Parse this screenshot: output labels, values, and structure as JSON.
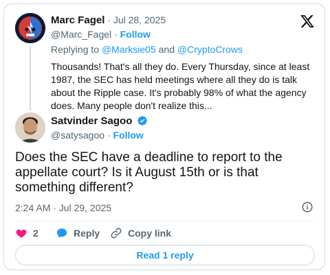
{
  "parent": {
    "name": "Marc Fagel",
    "date": "Jul 28, 2025",
    "handle": "@Marc_Fagel",
    "follow": "Follow",
    "replying_prefix": "Replying to",
    "replying_user1": "@Marksie05",
    "replying_and": "and",
    "replying_user2": "@CryptoCrows",
    "body": "Thousands! That's all they do. Every Thursday, since at least 1987, the SEC has held meetings where all they do is talk about the Ripple case. It's probably 98% of what the agency does. Many people don't realize this..."
  },
  "main": {
    "name": "Satvinder Sagoo",
    "handle": "@satysagoo",
    "follow": "Follow",
    "body": "Does the SEC have a deadline to report to the appellate court? Is it August 15th or is that something different?",
    "timestamp": "2:24 AM · Jul 29, 2025"
  },
  "actions": {
    "like_count": "2",
    "reply_label": "Reply",
    "copy_label": "Copy link"
  },
  "read_replies": "Read 1 reply",
  "icons": {
    "brand": "x-logo-icon",
    "verified": "verified-badge-icon",
    "info": "info-icon",
    "like": "heart-icon",
    "reply": "speech-bubble-icon",
    "copy": "link-icon"
  },
  "colors": {
    "accent": "#1d9bf0",
    "like": "#f91880",
    "muted": "#536471",
    "border": "#cfd9de"
  }
}
